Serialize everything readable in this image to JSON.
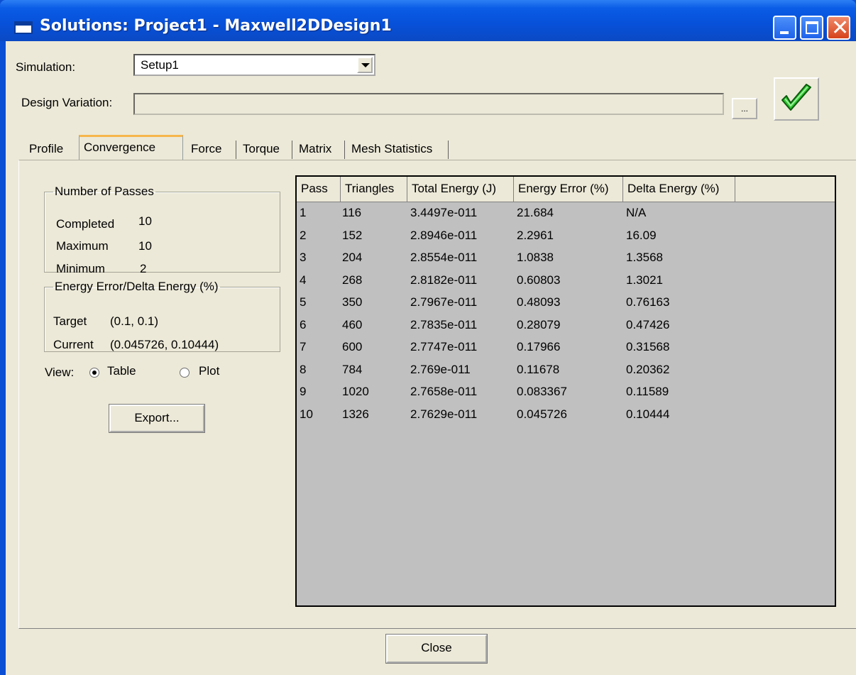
{
  "window": {
    "title": "Solutions: Project1 - Maxwell2DDesign1",
    "close_glyph": "✕"
  },
  "simulation": {
    "label": "Simulation:",
    "value": "Setup1"
  },
  "design_variation": {
    "label": "Design Variation:",
    "value": "",
    "browse_label": "..."
  },
  "status_icon": "green-checkmark-icon",
  "tabs": [
    "Profile",
    "Convergence",
    "Force",
    "Torque",
    "Matrix",
    "Mesh Statistics"
  ],
  "active_tab": "Convergence",
  "passes": {
    "title": "Number of Passes",
    "completed_label": "Completed",
    "completed_value": "10",
    "maximum_label": "Maximum",
    "maximum_value": "10",
    "minimum_label": "Minimum",
    "minimum_value": "2"
  },
  "energy": {
    "title": "Energy Error/Delta Energy (%)",
    "target_label": "Target",
    "target_value": "(0.1, 0.1)",
    "current_label": "Current",
    "current_value": "(0.045726, 0.10444)"
  },
  "view": {
    "label": "View:",
    "table_label": "Table",
    "plot_label": "Plot",
    "selected": "Table"
  },
  "export_label": "Export...",
  "close_label": "Close",
  "table": {
    "columns": [
      "Pass",
      "Triangles",
      "Total Energy (J)",
      "Energy Error (%)",
      "Delta Energy (%)"
    ],
    "rows": [
      [
        "1",
        "116",
        "3.4497e-011",
        "21.684",
        "N/A"
      ],
      [
        "2",
        "152",
        "2.8946e-011",
        "2.2961",
        "16.09"
      ],
      [
        "3",
        "204",
        "2.8554e-011",
        "1.0838",
        "1.3568"
      ],
      [
        "4",
        "268",
        "2.8182e-011",
        "0.60803",
        "1.3021"
      ],
      [
        "5",
        "350",
        "2.7967e-011",
        "0.48093",
        "0.76163"
      ],
      [
        "6",
        "460",
        "2.7835e-011",
        "0.28079",
        "0.47426"
      ],
      [
        "7",
        "600",
        "2.7747e-011",
        "0.17966",
        "0.31568"
      ],
      [
        "8",
        "784",
        "2.769e-011",
        "0.11678",
        "0.20362"
      ],
      [
        "9",
        "1020",
        "2.7658e-011",
        "0.083367",
        "0.11589"
      ],
      [
        "10",
        "1326",
        "2.7629e-011",
        "0.045726",
        "0.10444"
      ]
    ]
  }
}
